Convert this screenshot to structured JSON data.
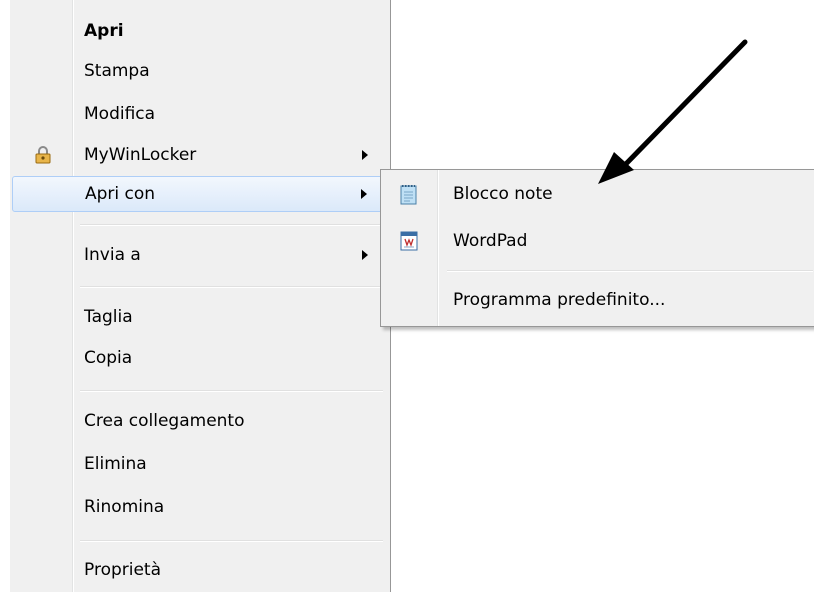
{
  "context_menu": {
    "items": [
      {
        "label": "Apri"
      },
      {
        "label": "Stampa"
      },
      {
        "label": "Modifica"
      },
      {
        "label": "MyWinLocker"
      },
      {
        "label": "Apri con"
      },
      {
        "label": "Invia a"
      },
      {
        "label": "Taglia"
      },
      {
        "label": "Copia"
      },
      {
        "label": "Crea collegamento"
      },
      {
        "label": "Elimina"
      },
      {
        "label": "Rinomina"
      },
      {
        "label": "Proprietà"
      }
    ]
  },
  "submenu": {
    "items": [
      {
        "label": "Blocco note"
      },
      {
        "label": "WordPad"
      },
      {
        "label": "Programma predefinito..."
      }
    ]
  },
  "colors": {
    "menu_background": "#f0f0f0",
    "highlight_border": "#aecef7",
    "annotation_arrow": "#000000"
  }
}
